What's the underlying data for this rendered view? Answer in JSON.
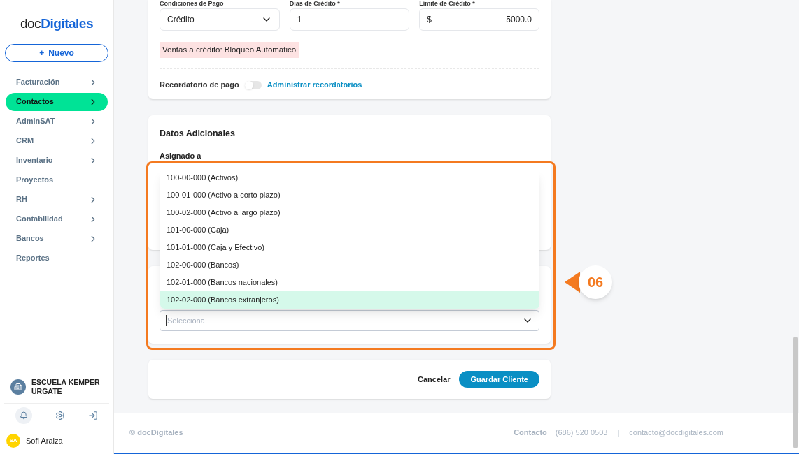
{
  "sidebar": {
    "logo": {
      "light": "doc",
      "bold": "Digitales"
    },
    "new_button": {
      "icon": "+",
      "label": "Nuevo"
    },
    "items": [
      {
        "label": "Facturación",
        "selected": false,
        "has_submenu": true
      },
      {
        "label": "Contactos",
        "selected": true,
        "has_submenu": true
      },
      {
        "label": "AdminSAT",
        "selected": false,
        "has_submenu": true
      },
      {
        "label": "CRM",
        "selected": false,
        "has_submenu": true
      },
      {
        "label": "Inventario",
        "selected": false,
        "has_submenu": true
      },
      {
        "label": "Proyectos",
        "selected": false,
        "has_submenu": false
      },
      {
        "label": "RH",
        "selected": false,
        "has_submenu": true
      },
      {
        "label": "Contabilidad",
        "selected": false,
        "has_submenu": true
      },
      {
        "label": "Bancos",
        "selected": false,
        "has_submenu": true
      },
      {
        "label": "Reportes",
        "selected": false,
        "has_submenu": false
      }
    ],
    "company": "ESCUELA KEMPER URGATE",
    "user": {
      "initials": "SA",
      "name": "Sofi Araiza"
    }
  },
  "credit": {
    "fields": [
      {
        "label": "Condiciones de Pago",
        "kind": "select",
        "value": "Crédito"
      },
      {
        "label": "Días de Crédito *",
        "kind": "text",
        "value": "1"
      },
      {
        "label": "Límite de Crédito *",
        "kind": "money",
        "prefix": "$",
        "value": "5000.0"
      }
    ],
    "notice": "Ventas a crédito: Bloqueo Automático",
    "reminder": {
      "label": "Recordatorio de pago",
      "on": false,
      "link": "Administrar recordatorios"
    }
  },
  "additional": {
    "title": "Datos Adicionales",
    "assigned_label": "Asignado a"
  },
  "account_select": {
    "placeholder": "Selecciona",
    "options": [
      {
        "label": "100-00-000 (Activos)",
        "selected": false
      },
      {
        "label": "100-01-000 (Activo a corto plazo)",
        "selected": false
      },
      {
        "label": "100-02-000 (Activo a largo plazo)",
        "selected": false
      },
      {
        "label": "101-00-000 (Caja)",
        "selected": false
      },
      {
        "label": "101-01-000 (Caja y Efectivo)",
        "selected": false
      },
      {
        "label": "102-00-000 (Bancos)",
        "selected": false
      },
      {
        "label": "102-01-000 (Bancos nacionales)",
        "selected": false
      },
      {
        "label": "102-02-000 (Bancos extranjeros)",
        "selected": true
      }
    ]
  },
  "step_badge": "06",
  "actions": [
    "Cancelar",
    "Guardar Cliente"
  ],
  "footer": {
    "copyright": "© docDigitales",
    "contact_label": "Contacto",
    "phone": "(686) 520 0503",
    "separator": "|",
    "email": "contacto@docdigitales.com"
  }
}
